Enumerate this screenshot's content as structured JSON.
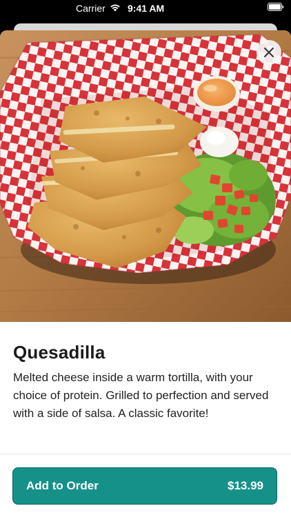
{
  "status_bar": {
    "carrier": "Carrier",
    "time": "9:41 AM"
  },
  "hero": {
    "image_subject": "quesadilla with salsa, lettuce, tomato and sour cream in a red-white checkered paper basket"
  },
  "item": {
    "title": "Quesadilla",
    "description": "Melted cheese inside a warm tortilla, with your choice of protein. Grilled to perfection and served with a side of salsa. A classic favorite!"
  },
  "order_button": {
    "label": "Add to Order",
    "price": "$13.99"
  },
  "colors": {
    "accent": "#15918a",
    "accent_border": "#0b5f5b",
    "checker_red": "#d8323a"
  },
  "icons": {
    "close": "close-icon",
    "wifi": "wifi-icon",
    "battery": "battery-icon"
  }
}
